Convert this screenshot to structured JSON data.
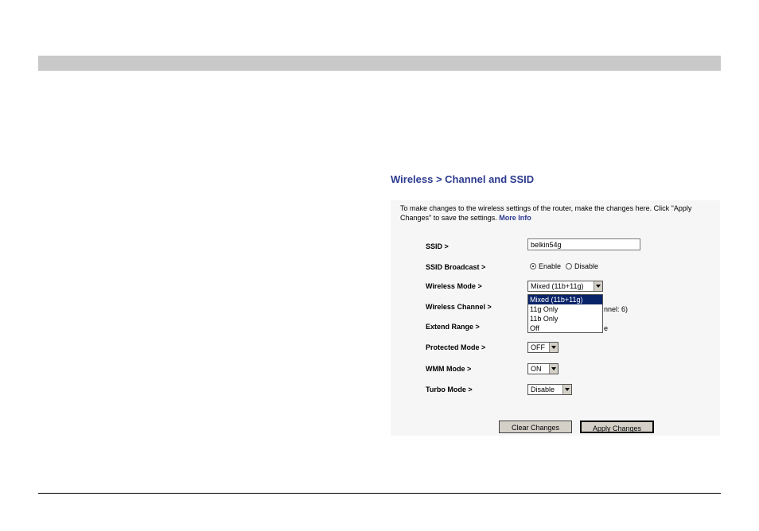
{
  "page": {
    "heading": "Wireless > Channel and SSID",
    "intro_text": "To make changes to the wireless settings of the router, make the changes here. Click \"Apply Changes\" to save the settings. ",
    "more_info_link": "More Info"
  },
  "form": {
    "ssid": {
      "label": "SSID >",
      "value": "belkin54g"
    },
    "ssid_broadcast": {
      "label": "SSID Broadcast >",
      "options": [
        "Enable",
        "Disable"
      ],
      "selected": "Enable"
    },
    "wireless_mode": {
      "label": "Wireless Mode >",
      "value": "Mixed (11b+11g)",
      "options": [
        "Mixed (11b+11g)",
        "11g Only",
        "11b Only",
        "Off"
      ],
      "highlighted": "Mixed (11b+11g)"
    },
    "wireless_channel": {
      "label": "Wireless Channel >",
      "partial_text": "nnel: 6)"
    },
    "extend_range": {
      "label": "Extend Range >",
      "partial_text": "e"
    },
    "protected_mode": {
      "label": "Protected Mode >",
      "value": "OFF"
    },
    "wmm_mode": {
      "label": "WMM Mode >",
      "value": "ON"
    },
    "turbo_mode": {
      "label": "Turbo Mode >",
      "value": "Disable"
    }
  },
  "buttons": {
    "clear": "Clear Changes",
    "apply": "Apply Changes"
  },
  "colors": {
    "heading": "#2b3a8f",
    "top_bar": "#c9c9c9",
    "selection": "#0a246a",
    "button_face": "#d4d0c8"
  }
}
